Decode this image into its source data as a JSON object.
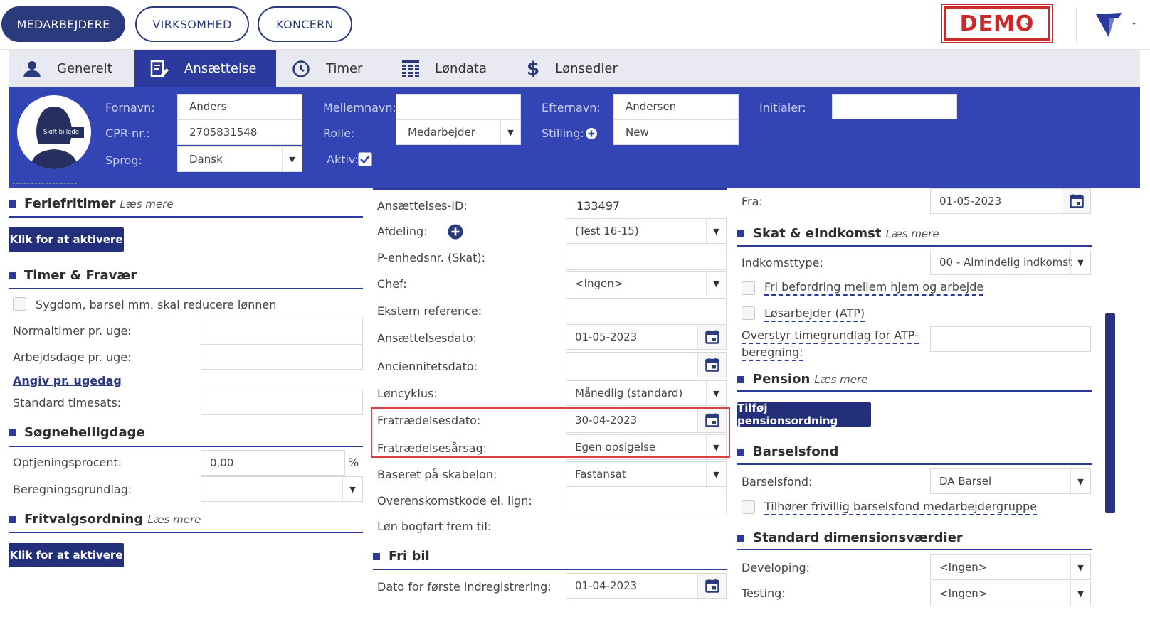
{
  "topnav": {
    "tabs": [
      {
        "label": "MEDARBEJDERE",
        "active": true
      },
      {
        "label": "VIRKSOMHED",
        "active": false
      },
      {
        "label": "KONCERN",
        "active": false
      }
    ],
    "demo_label": "DEMO"
  },
  "subtabs": [
    {
      "label": "Generelt",
      "icon": "person-icon"
    },
    {
      "label": "Ansættelse",
      "icon": "edit-document-icon",
      "active": true
    },
    {
      "label": "Timer",
      "icon": "clock-icon"
    },
    {
      "label": "Løndata",
      "icon": "table-icon"
    },
    {
      "label": "Lønsedler",
      "icon": "dollar-icon"
    }
  ],
  "colors": {
    "primary": "#2b3a7c",
    "banner": "#3344b5",
    "highlight": "#d94040",
    "demo": "#cc2929"
  },
  "header": {
    "avatar_label": "Skift billede",
    "fornavn": {
      "label": "Fornavn:",
      "value": "Anders"
    },
    "mellemnavn": {
      "label": "Mellemnavn:",
      "value": ""
    },
    "efternavn": {
      "label": "Efternavn:",
      "value": "Andersen"
    },
    "initialer": {
      "label": "Initialer:",
      "value": ""
    },
    "cpr": {
      "label": "CPR-nr.:",
      "value": "2705831548"
    },
    "rolle": {
      "label": "Rolle:",
      "value": "Medarbejder"
    },
    "stilling": {
      "label": "Stilling:",
      "value": "New"
    },
    "sprog": {
      "label": "Sprog:",
      "value": "Dansk"
    },
    "aktiv": {
      "label": "Aktiv:",
      "checked": true
    }
  },
  "left": {
    "feriefritimer": {
      "title": "Feriefritimer",
      "laes": "Læs mere",
      "button": "Klik for at aktivere"
    },
    "timer_fravaer": {
      "title": "Timer & Fravær",
      "sygdom": "Sygdom, barsel mm. skal reducere lønnen",
      "normaltimer": "Normaltimer pr. uge:",
      "arbejdsdage": "Arbejdsdage pr. uge:",
      "angiv": "Angiv pr. ugedag",
      "timesats": "Standard timesats:"
    },
    "sogne": {
      "title": "Søgnehelligdage",
      "optjening": "Optjeningsprocent:",
      "optjening_value": "0,00",
      "pct": "%",
      "beregning": "Beregningsgrundlag:"
    },
    "fritvalg": {
      "title": "Fritvalgsordning",
      "laes": "Læs mere",
      "button": "Klik for at aktivere"
    }
  },
  "middle": {
    "ansid": {
      "label": "Ansættelses-ID:",
      "value": "133497"
    },
    "afdeling": {
      "label": "Afdeling:",
      "value": "(Test 16-15)"
    },
    "penhed": {
      "label": "P-enhedsnr. (Skat):",
      "value": ""
    },
    "chef": {
      "label": "Chef:",
      "value": "<Ingen>"
    },
    "ekstern": {
      "label": "Ekstern reference:",
      "value": ""
    },
    "ansdato": {
      "label": "Ansættelsesdato:",
      "value": "01-05-2023"
    },
    "ancdato": {
      "label": "Anciennitetsdato:",
      "value": ""
    },
    "loncyklus": {
      "label": "Løncyklus:",
      "value": "Månedlig (standard)"
    },
    "fratdato": {
      "label": "Fratrædelsesdato:",
      "value": "30-04-2023"
    },
    "fratarsag": {
      "label": "Fratrædelsesårsag:",
      "value": "Egen opsigelse"
    },
    "skabelon": {
      "label": "Baseret på skabelon:",
      "value": "Fastansat"
    },
    "overens": {
      "label": "Overenskomstkode el. lign:",
      "value": ""
    },
    "bogfort": {
      "label": "Løn bogført frem til:",
      "value": ""
    },
    "fribil": {
      "title": "Fri bil",
      "dato_label": "Dato for første indregistrering:",
      "dato_value": "01-04-2023"
    }
  },
  "right": {
    "fra": {
      "label": "Fra:",
      "value": "01-05-2023"
    },
    "skat": {
      "title": "Skat & eIndkomst",
      "laes": "Læs mere",
      "indkomst_label": "Indkomsttype:",
      "indkomst_value": "00 - Almindelig indkomst",
      "fri_befordring": "Fri befordring mellem hjem og arbejde",
      "losarbejder": "Løsarbejder (ATP)",
      "overstyr_1": "Overstyr timegrundlag for ATP-",
      "overstyr_2": "beregning:"
    },
    "pension": {
      "title": "Pension",
      "laes": "Læs mere",
      "button": "Tilføj pensionsordning"
    },
    "barsel": {
      "title": "Barselsfond",
      "label": "Barselsfond:",
      "value": "DA Barsel",
      "tilhorer": "Tilhører frivillig barselsfond medarbejdergruppe"
    },
    "dims": {
      "title": "Standard dimensionsværdier",
      "developing_label": "Developing:",
      "developing_value": "<Ingen>",
      "testing_label": "Testing:",
      "testing_value": "<Ingen>"
    }
  }
}
